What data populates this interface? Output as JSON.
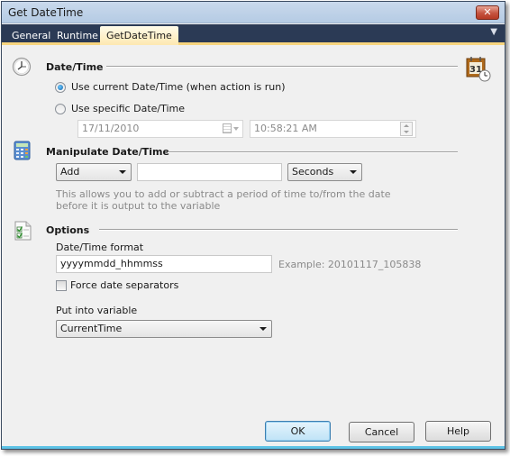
{
  "window": {
    "title": "Get DateTime",
    "close_label": "✕"
  },
  "tabs": [
    {
      "label": "General",
      "active": false
    },
    {
      "label": "Runtime",
      "active": false
    },
    {
      "label": "GetDateTime",
      "active": true
    }
  ],
  "tab_menu_icon": "▼",
  "datetime_section": {
    "title": "Date/Time",
    "icon": "clock-icon",
    "corner_icon": "calendar-clock-icon",
    "calendar_day": "31",
    "options": [
      {
        "label": "Use current Date/Time (when action is run)",
        "checked": true
      },
      {
        "label": "Use specific Date/Time",
        "checked": false
      }
    ],
    "date_value": "17/11/2010",
    "time_value": "10:58:21 AM"
  },
  "manipulate_section": {
    "title": "Manipulate Date/Time",
    "icon": "calculator-icon",
    "operation": "Add",
    "amount_value": "",
    "unit": "Seconds",
    "help_line1": "This allows you to add or subtract a period of time to/from the date",
    "help_line2": "before it is output to the variable"
  },
  "options_section": {
    "title": "Options",
    "icon": "checklist-icon",
    "format_label": "Date/Time format",
    "format_value": "yyyymmdd_hhmmss",
    "example_text": "Example: 20101117_105838",
    "force_separators_label": "Force date separators",
    "force_separators_checked": false,
    "variable_label": "Put into variable",
    "variable_value": "CurrentTime"
  },
  "buttons": {
    "ok": "OK",
    "cancel": "Cancel",
    "help": "Help"
  }
}
